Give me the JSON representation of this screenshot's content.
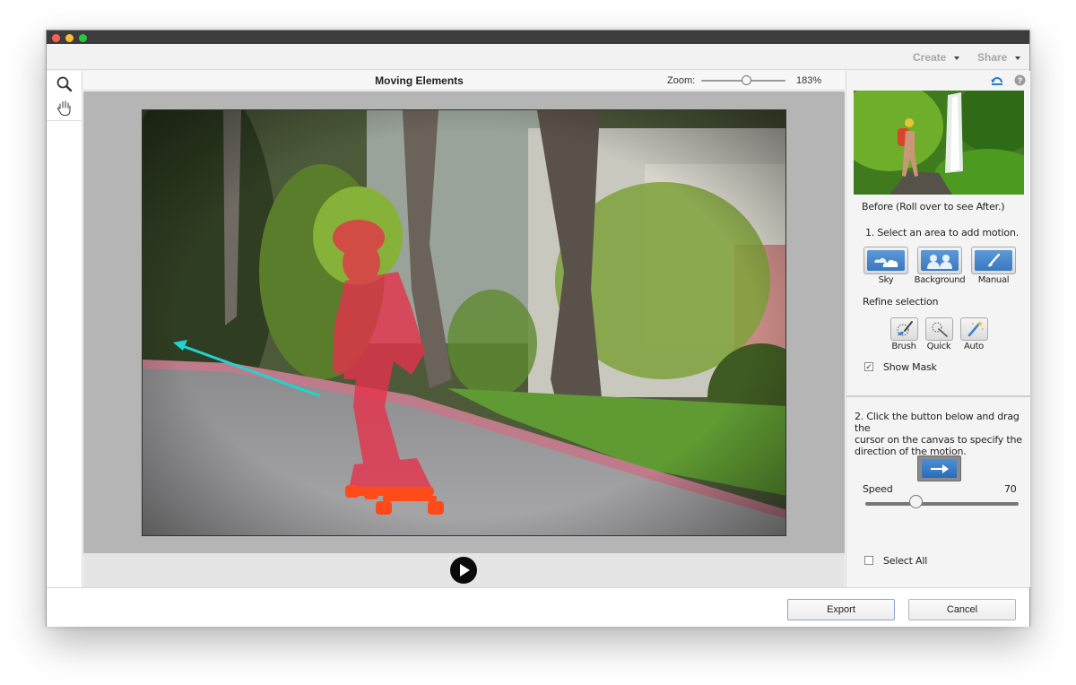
{
  "window": {
    "traffic_lights": [
      "close",
      "minimize",
      "zoom"
    ]
  },
  "topbar": {
    "create_label": "Create",
    "share_label": "Share"
  },
  "tools": {
    "items": [
      {
        "name": "zoom-tool",
        "icon": "magnifier-icon"
      },
      {
        "name": "hand-tool",
        "icon": "hand-icon"
      }
    ]
  },
  "document": {
    "title": "Moving Elements",
    "zoom_label": "Zoom:",
    "zoom_value": "183%",
    "zoom_level_percent": 183
  },
  "canvas": {
    "image_description": "Child in pink helmet and shirt on orange longboard riding down a tree-lined street, with red motion mask over the child and a cyan direction arrow pointing left-up",
    "mask_color": "#e8304a",
    "motion_arrow_color": "#22d3d0"
  },
  "playback": {
    "play_icon": "play-icon"
  },
  "panel": {
    "reset_icon": "reset-icon",
    "help_icon": "help-icon",
    "before_caption": "Before (Roll over to see After.)",
    "step1": "1. Select an area to add motion.",
    "area_buttons": [
      {
        "label": "Sky",
        "icon": "cloud-icon"
      },
      {
        "label": "Background",
        "icon": "people-icon"
      },
      {
        "label": "Manual",
        "icon": "brush-icon"
      }
    ],
    "refine_label": "Refine selection",
    "refine_buttons": [
      {
        "label": "Brush",
        "icon": "selection-brush-icon"
      },
      {
        "label": "Quick",
        "icon": "quick-selection-icon"
      },
      {
        "label": "Auto",
        "icon": "magic-wand-icon"
      }
    ],
    "show_mask_label": "Show Mask",
    "show_mask_checked": true,
    "step2": "2. Click the button below and drag the cursor on the canvas to specify the direction of the motion.",
    "step2_lines": [
      "2. Click the button below and drag the",
      "cursor on the canvas to specify the",
      "direction of the motion."
    ],
    "direction_icon": "arrow-right-icon",
    "speed_label": "Speed",
    "speed_value": "70",
    "speed_fraction": 0.33,
    "select_all_label": "Select All",
    "select_all_checked": false
  },
  "footer": {
    "export_label": "Export",
    "cancel_label": "Cancel"
  }
}
